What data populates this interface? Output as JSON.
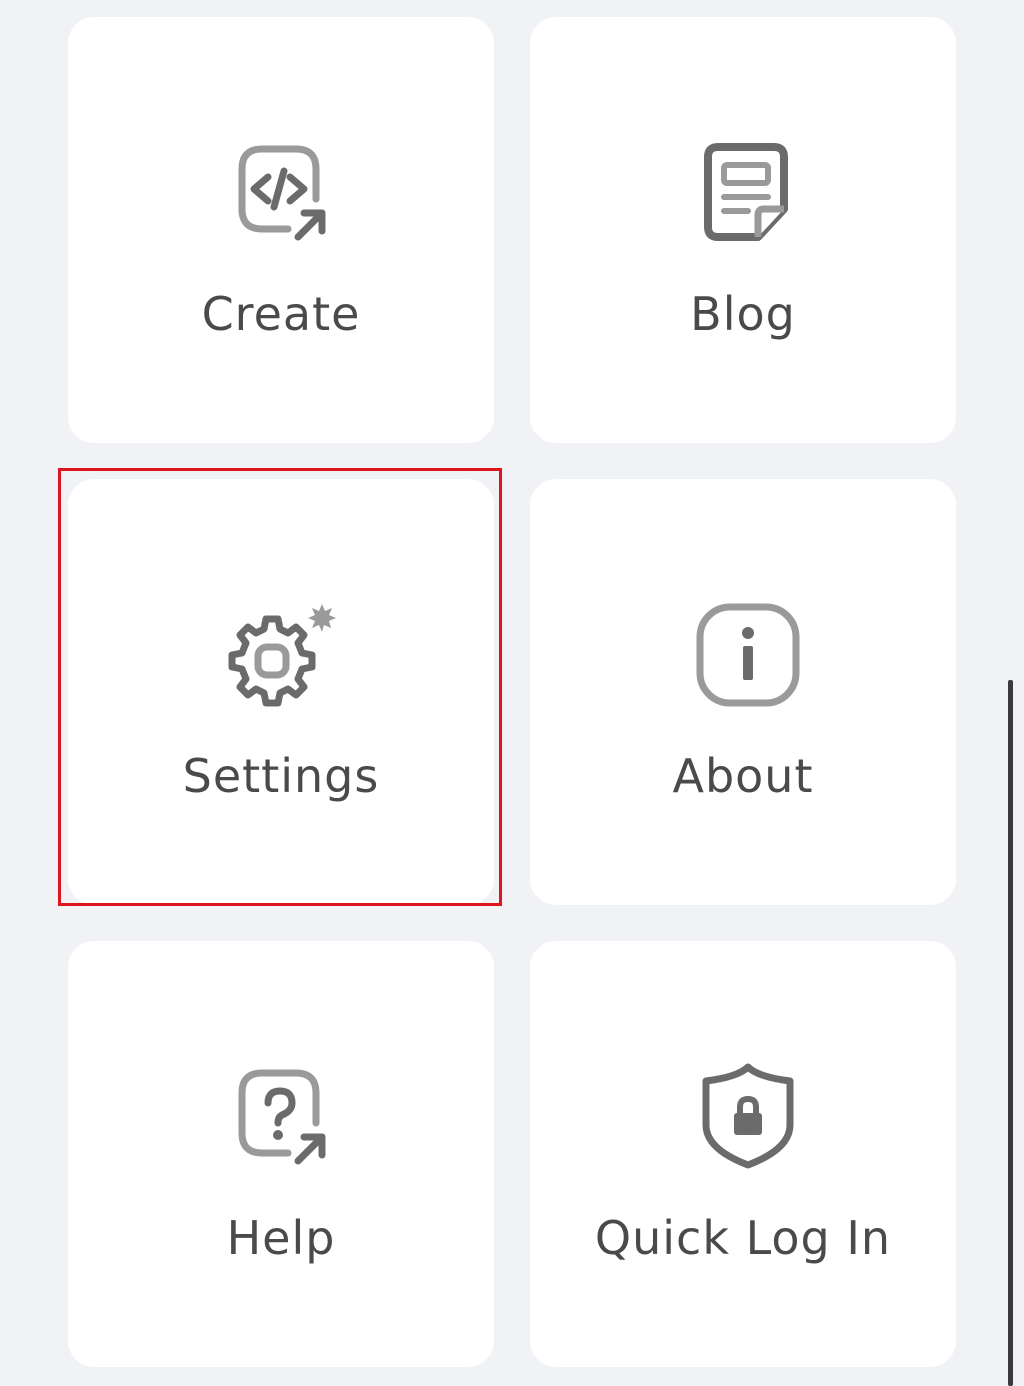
{
  "menu": {
    "items": [
      {
        "label": "Create",
        "icon": "create-external-icon"
      },
      {
        "label": "Blog",
        "icon": "blog-icon"
      },
      {
        "label": "Settings",
        "icon": "settings-gear-icon"
      },
      {
        "label": "About",
        "icon": "info-icon"
      },
      {
        "label": "Help",
        "icon": "help-external-icon"
      },
      {
        "label": "Quick Log In",
        "icon": "shield-lock-icon"
      }
    ],
    "highlighted": "Settings"
  },
  "colors": {
    "page_background": "#f1f2f5",
    "tile_background": "#ffffff",
    "icon_dark": "#6b6b6b",
    "icon_light": "#9a9a9a",
    "label": "#4a4a4a",
    "highlight_border": "#e0141e"
  }
}
